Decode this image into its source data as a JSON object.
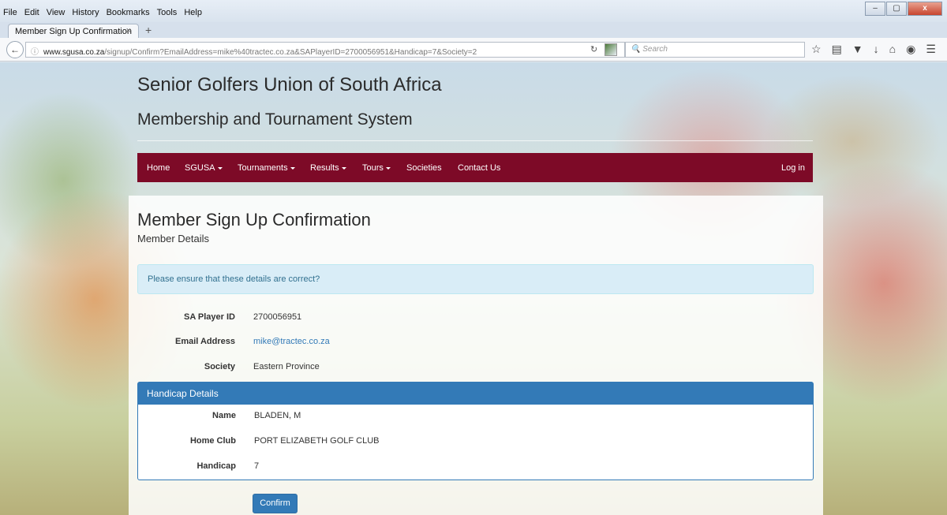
{
  "browser": {
    "menu": [
      "File",
      "Edit",
      "View",
      "History",
      "Bookmarks",
      "Tools",
      "Help"
    ],
    "tab_title": "Member Sign Up Confirmation",
    "tab_close": "×",
    "new_tab": "+",
    "url_host": "www.sgusa.co.za",
    "url_path": "/signup/Confirm?EmailAddress=mike%40tractec.co.za&SAPlayerID=2700056951&Handicap=7&Society=2",
    "search_placeholder": "Search",
    "window_buttons": {
      "minimize": "–",
      "maximize": "▢",
      "close": "x"
    }
  },
  "site": {
    "title": "Senior Golfers Union of South Africa",
    "subtitle": "Membership and Tournament System"
  },
  "nav": {
    "items": [
      {
        "label": "Home",
        "dropdown": false
      },
      {
        "label": "SGUSA",
        "dropdown": true
      },
      {
        "label": "Tournaments",
        "dropdown": true
      },
      {
        "label": "Results",
        "dropdown": true
      },
      {
        "label": "Tours",
        "dropdown": true
      },
      {
        "label": "Societies",
        "dropdown": false
      },
      {
        "label": "Contact Us",
        "dropdown": false
      }
    ],
    "login": "Log in",
    "color": "#7d0a27"
  },
  "page": {
    "heading": "Member Sign Up Confirmation",
    "section": "Member Details",
    "alert": "Please ensure that these details are correct?",
    "member": {
      "player_id_label": "SA Player ID",
      "player_id": "2700056951",
      "email_label": "Email Address",
      "email": "mike@tractec.co.za",
      "society_label": "Society",
      "society": "Eastern Province"
    },
    "handicap_panel": {
      "title": "Handicap Details",
      "name_label": "Name",
      "name": "BLADEN, M",
      "club_label": "Home Club",
      "club": "PORT ELIZABETH GOLF CLUB",
      "handicap_label": "Handicap",
      "handicap": "7"
    },
    "confirm_button": "Confirm",
    "primary_color": "#337ab7"
  }
}
